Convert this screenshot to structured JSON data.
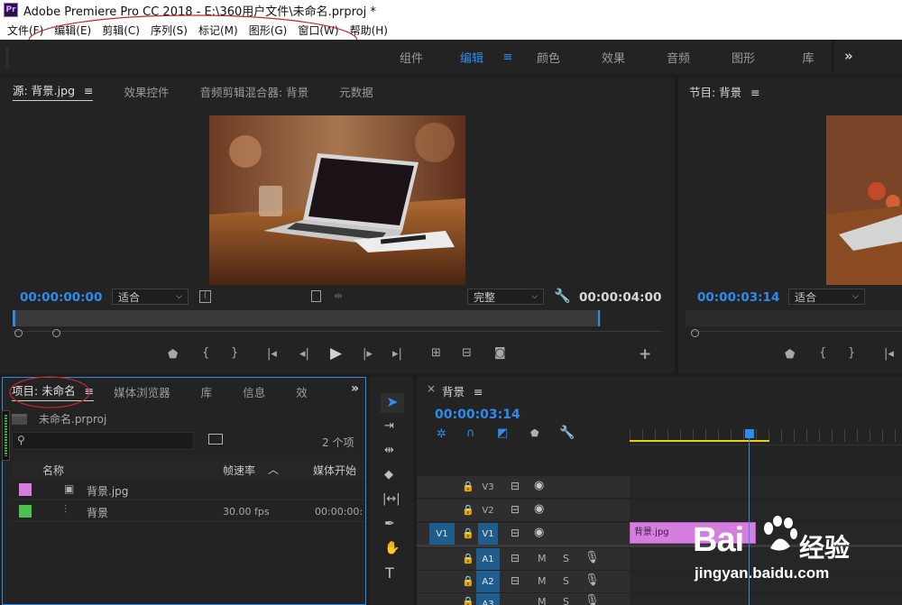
{
  "app": {
    "logo": "Pr",
    "title": "Adobe Premiere Pro CC 2018 - E:\\360用户文件\\未命名.prproj *"
  },
  "menu": [
    "文件(F)",
    "编辑(E)",
    "剪辑(C)",
    "序列(S)",
    "标记(M)",
    "图形(G)",
    "窗口(W)",
    "帮助(H)"
  ],
  "workspaces": {
    "tabs": [
      "组件",
      "编辑",
      "颜色",
      "效果",
      "音频",
      "图形",
      "库"
    ],
    "active": "编辑",
    "more": "»"
  },
  "source_monitor": {
    "tabs": [
      "源: 背景.jpg",
      "效果控件",
      "音频剪辑混合器: 背景",
      "元数据"
    ],
    "timecode_in": "00:00:00:00",
    "fit_select": "适合",
    "quality_select": "完整",
    "duration": "00:00:04:00"
  },
  "program_monitor": {
    "tab": "节目: 背景",
    "timecode": "00:00:03:14",
    "fit_select": "适合"
  },
  "project_panel": {
    "tabs": [
      "项目: 未命名",
      "媒体浏览器",
      "库",
      "信息",
      "效"
    ],
    "more": "»",
    "project_file": "未命名.prproj",
    "search_placeholder": "",
    "item_count": "2 个项",
    "columns": {
      "name": "名称",
      "framerate": "帧速率",
      "media_start": "媒体开始"
    },
    "items": [
      {
        "color": "#d67ee0",
        "name": "背景.jpg",
        "framerate": "",
        "media_start": ""
      },
      {
        "color": "#4cc04c",
        "name": "背景",
        "framerate": "30.00 fps",
        "media_start": "00:00:00:"
      }
    ]
  },
  "timeline": {
    "close": "×",
    "sequence_tab": "背景",
    "timecode": "00:00:03:14",
    "tracks_video": [
      "V3",
      "V2",
      "V1"
    ],
    "source_patch": "V1",
    "tracks_audio": [
      "A1",
      "A2",
      "A3"
    ],
    "mute_label": "M",
    "solo_label": "S",
    "clip_label": "背景.jpg"
  },
  "watermark": {
    "brand": "Bai",
    "brand_cn": "经验",
    "url": "jingyan.baidu.com"
  },
  "colors": {
    "accent_blue": "#2d8ceb",
    "clip_pink": "#d67ee0",
    "annotation_red": "#c0282a"
  }
}
